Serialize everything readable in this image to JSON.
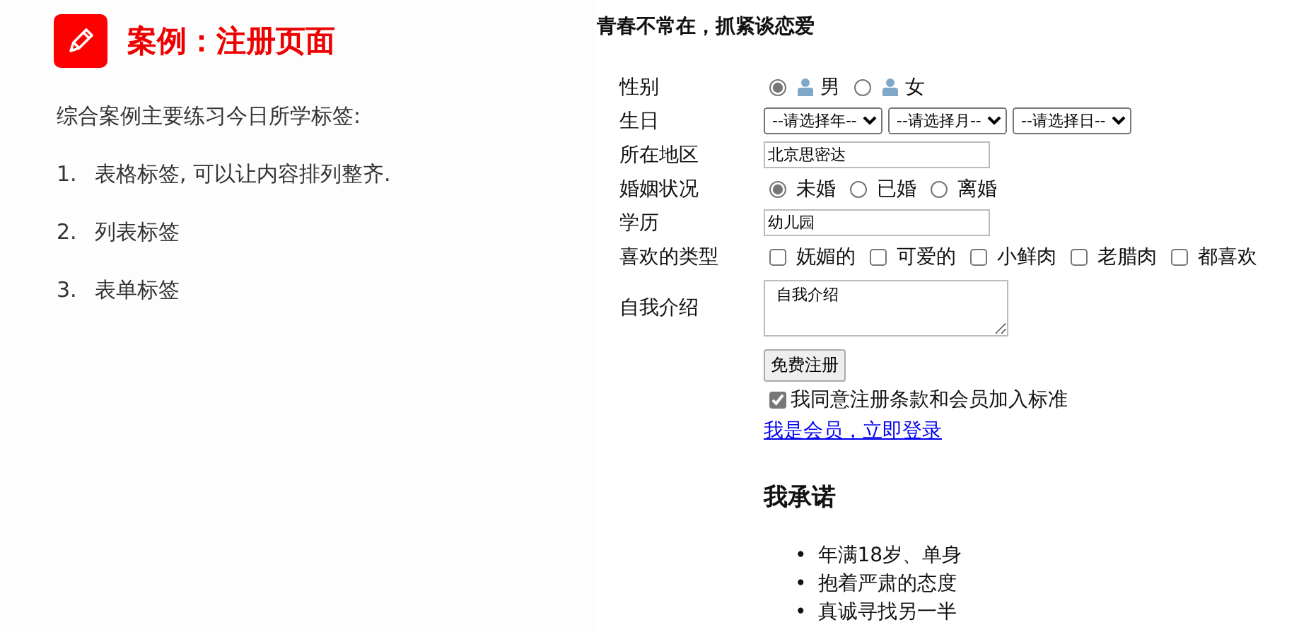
{
  "slide": {
    "title": "案例：注册页面",
    "intro": "综合案例主要练习今日所学标签:",
    "points": [
      {
        "number": "1.",
        "text": "表格标签, 可以让内容排列整齐."
      },
      {
        "number": "2.",
        "text": "列表标签"
      },
      {
        "number": "3.",
        "text": "表单标签"
      }
    ]
  },
  "page": {
    "heading": "青春不常在，抓紧谈恋爱",
    "form": [
      {
        "kind": "icon_radio",
        "label": "性别",
        "options": [
          {
            "text": "男",
            "selected": true
          },
          {
            "text": "女",
            "selected": false
          }
        ]
      },
      {
        "kind": "select",
        "label": "生日",
        "selects": [
          "--请选择年--",
          "--请选择月--",
          "--请选择日--"
        ]
      },
      {
        "kind": "text",
        "label": "所在地区",
        "value": "北京思密达"
      },
      {
        "kind": "radio",
        "label": "婚姻状况",
        "options": [
          {
            "text": "未婚",
            "selected": true
          },
          {
            "text": "已婚",
            "selected": false
          },
          {
            "text": "离婚",
            "selected": false
          }
        ]
      },
      {
        "kind": "text",
        "label": "学历",
        "value": "幼儿园"
      },
      {
        "kind": "checkbox",
        "label": "喜欢的类型",
        "options": [
          {
            "text": "妩媚的",
            "checked": false
          },
          {
            "text": "可爱的",
            "checked": false
          },
          {
            "text": "小鲜肉",
            "checked": false
          },
          {
            "text": "老腊肉",
            "checked": false
          },
          {
            "text": "都喜欢",
            "checked": false
          }
        ]
      },
      {
        "kind": "textarea",
        "label": "自我介绍",
        "value": "自我介绍"
      }
    ],
    "submit": "免费注册",
    "agreement": {
      "label": "我同意注册条款和会员加入标准",
      "checked": true
    },
    "login_link": "我是会员，立即登录",
    "promise": {
      "heading": "我承诺",
      "items": [
        {
          "bullet": "•",
          "text": "年满18岁、单身"
        },
        {
          "bullet": "•",
          "text": "抱着严肃的态度"
        },
        {
          "bullet": "•",
          "text": "真诚寻找另一半"
        }
      ]
    }
  }
}
